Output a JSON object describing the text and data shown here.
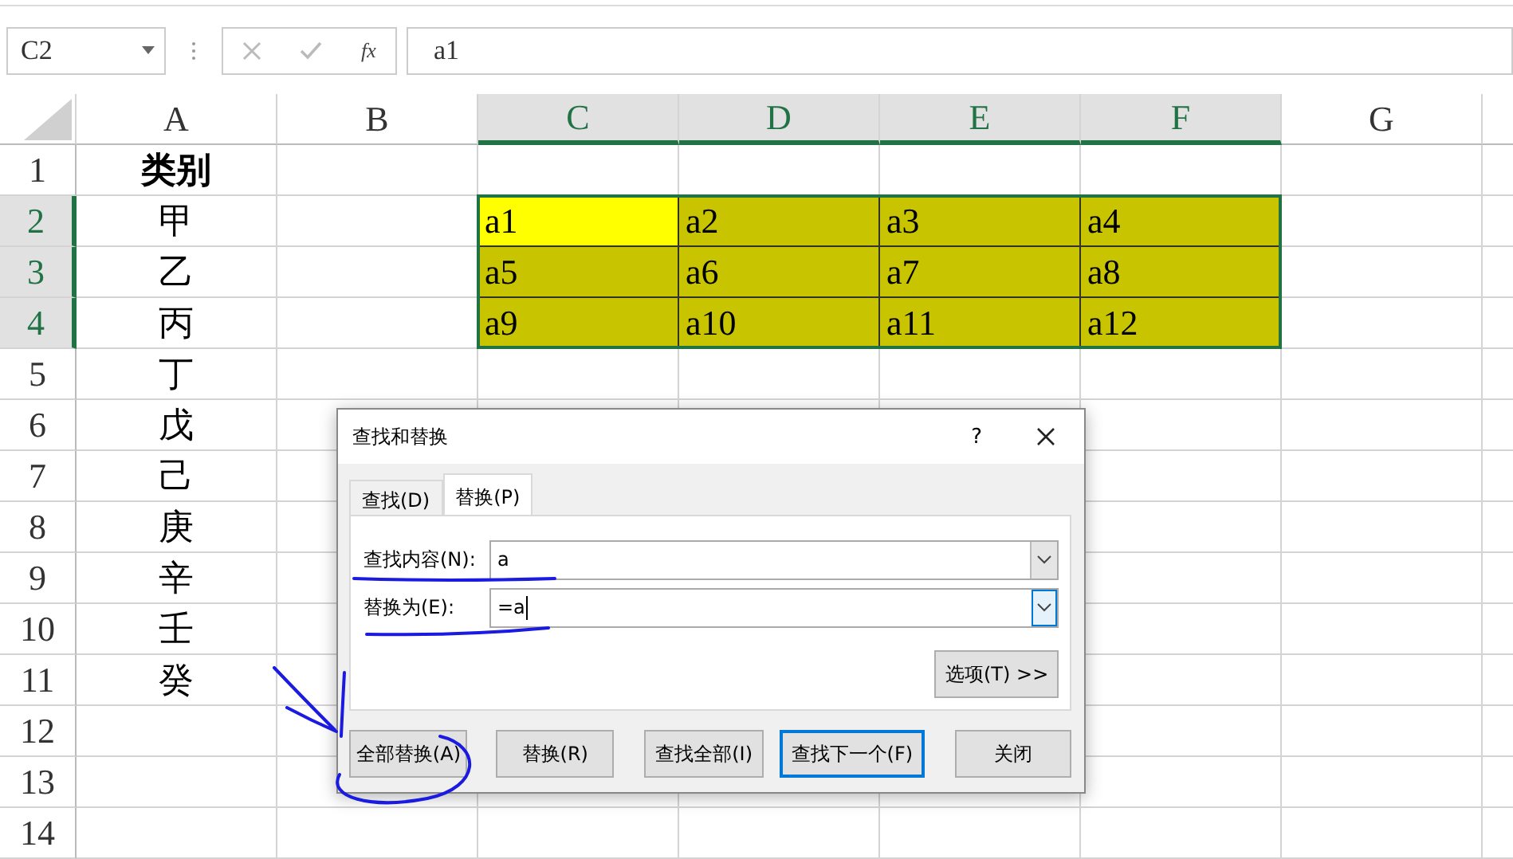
{
  "formula_bar": {
    "name_box": "C2",
    "function_label": "fx",
    "value": "a1"
  },
  "sheet": {
    "columns": [
      {
        "label": "A",
        "selected": false
      },
      {
        "label": "B",
        "selected": false
      },
      {
        "label": "C",
        "selected": true
      },
      {
        "label": "D",
        "selected": true
      },
      {
        "label": "E",
        "selected": true
      },
      {
        "label": "F",
        "selected": true
      },
      {
        "label": "G",
        "selected": false
      }
    ],
    "rows": [
      {
        "label": "1",
        "selected": false,
        "category": {
          "text": "类别",
          "kind": "header"
        }
      },
      {
        "label": "2",
        "selected": true,
        "category": {
          "text": "甲",
          "kind": "plain"
        },
        "range": [
          {
            "text": "a1",
            "active": true
          },
          {
            "text": "a2",
            "active": false
          },
          {
            "text": "a3",
            "active": false
          },
          {
            "text": "a4",
            "active": false
          }
        ]
      },
      {
        "label": "3",
        "selected": true,
        "category": {
          "text": "乙",
          "kind": "plain"
        },
        "range": [
          {
            "text": "a5",
            "active": false
          },
          {
            "text": "a6",
            "active": false
          },
          {
            "text": "a7",
            "active": false
          },
          {
            "text": "a8",
            "active": false
          }
        ]
      },
      {
        "label": "4",
        "selected": true,
        "category": {
          "text": "丙",
          "kind": "plain"
        },
        "range": [
          {
            "text": "a9",
            "active": false
          },
          {
            "text": "a10",
            "active": false
          },
          {
            "text": "a11",
            "active": false
          },
          {
            "text": "a12",
            "active": false
          }
        ]
      },
      {
        "label": "5",
        "selected": false,
        "category": {
          "text": "丁",
          "kind": "plain"
        }
      },
      {
        "label": "6",
        "selected": false,
        "category": {
          "text": "戊",
          "kind": "plain"
        }
      },
      {
        "label": "7",
        "selected": false,
        "category": {
          "text": "己",
          "kind": "plain"
        }
      },
      {
        "label": "8",
        "selected": false,
        "category": {
          "text": "庚",
          "kind": "plain"
        }
      },
      {
        "label": "9",
        "selected": false,
        "category": {
          "text": "辛",
          "kind": "plain"
        }
      },
      {
        "label": "10",
        "selected": false,
        "category": {
          "text": "壬",
          "kind": "plain"
        }
      },
      {
        "label": "11",
        "selected": false,
        "category": {
          "text": "癸",
          "kind": "plain"
        }
      },
      {
        "label": "12",
        "selected": false
      },
      {
        "label": "13",
        "selected": false
      },
      {
        "label": "14",
        "selected": false
      }
    ]
  },
  "dialog": {
    "title": "查找和替换",
    "help": "?",
    "tabs": [
      {
        "label": "查找(D)",
        "selected": false
      },
      {
        "label": "替换(P)",
        "selected": true
      }
    ],
    "fields": [
      {
        "label": "查找内容(N):",
        "value": "a",
        "focused": false
      },
      {
        "label": "替换为(E):",
        "value": "=a",
        "focused": true
      }
    ],
    "options_button": "选项(T) >>",
    "buttons": [
      {
        "label": "全部替换(A)",
        "default": false
      },
      {
        "label": "替换(R)",
        "default": false
      },
      {
        "label": "查找全部(I)",
        "default": false
      },
      {
        "label": "查找下一个(F)",
        "default": true
      },
      {
        "label": "关闭",
        "default": false
      }
    ]
  }
}
